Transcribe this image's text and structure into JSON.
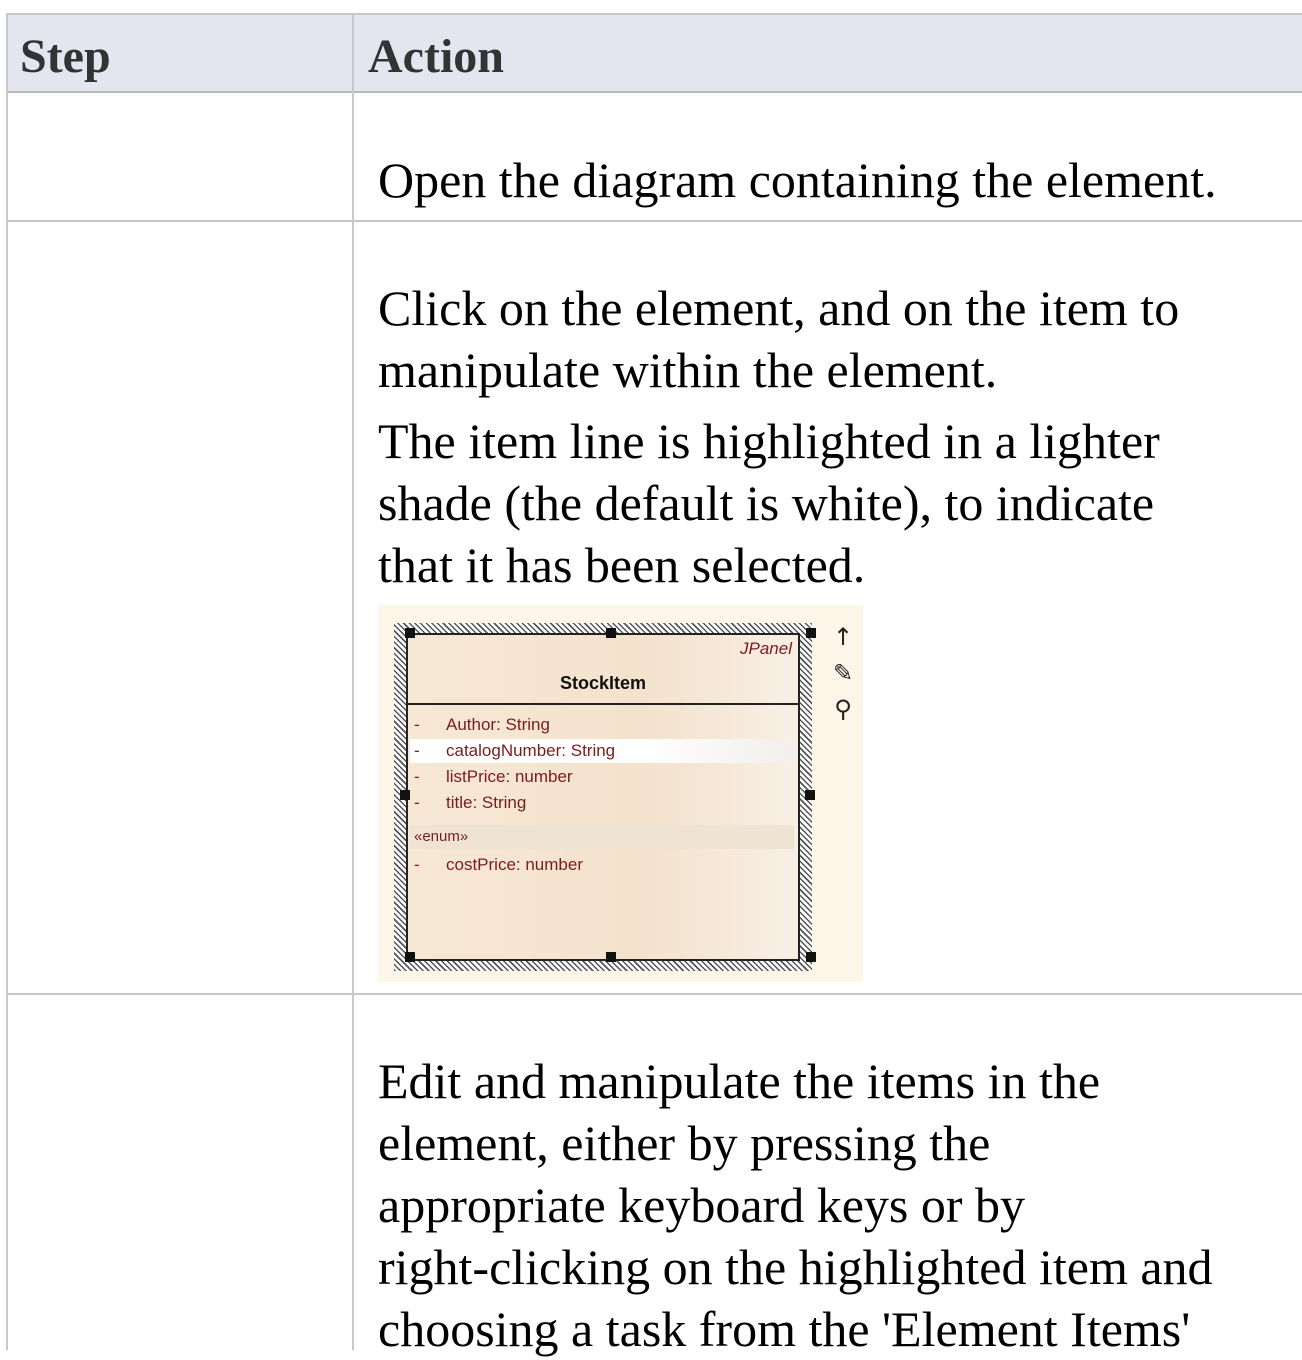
{
  "table": {
    "headers": {
      "step": "Step",
      "action": "Action"
    },
    "rows": [
      {
        "step": "",
        "action": [
          "Open the diagram containing the element."
        ]
      },
      {
        "step": "",
        "action": [
          "Click on the element, and on the item to",
          "manipulate within the element.",
          "The item line is highlighted in a lighter",
          "shade (the default is white), to indicate",
          "that it has been selected."
        ]
      },
      {
        "step": "",
        "action": [
          "Edit and manipulate the items in the",
          "element, either by pressing the",
          "appropriate keyboard keys or by",
          "right-clicking on the highlighted item and",
          "choosing a task from the 'Element Items'"
        ]
      }
    ]
  },
  "diagram": {
    "stereotype": "JPanel",
    "class_name": "StockItem",
    "attributes": [
      {
        "vis": "-",
        "text": "Author:  String",
        "selected": false
      },
      {
        "vis": "-",
        "text": "catalogNumber:  String",
        "selected": true
      },
      {
        "vis": "-",
        "text": "listPrice:  number",
        "selected": false
      },
      {
        "vis": "-",
        "text": "title:  String",
        "selected": false
      }
    ],
    "enum_label": "«enum»",
    "enum_attributes": [
      {
        "vis": "-",
        "text": "costPrice:  number"
      }
    ],
    "icons": [
      "up-arrow-icon",
      "paint-icon",
      "magnifier-icon"
    ],
    "colors": {
      "attribute_text": "#7a1c1c",
      "element_fill": "#f7e8d6",
      "highlight": "#ffffff"
    }
  }
}
